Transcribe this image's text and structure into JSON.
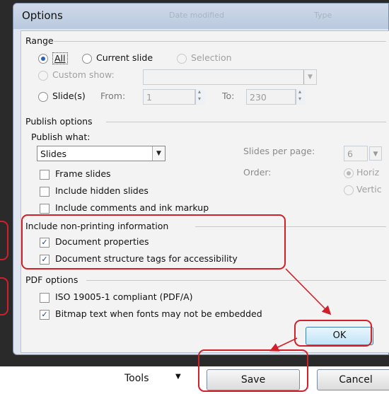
{
  "dialog": {
    "title": "Options",
    "ghost_header_left": "Date modified",
    "ghost_header_right": "Type"
  },
  "range": {
    "title": "Range",
    "all_label": "All",
    "current_slide_label": "Current slide",
    "selection_label": "Selection",
    "custom_show_label": "Custom show:",
    "slides_label": "Slide(s)",
    "from_label": "From:",
    "from_value": "1",
    "to_label": "To:",
    "to_value": "230"
  },
  "publish": {
    "title": "Publish options",
    "publish_what_label": "Publish what:",
    "publish_what_value": "Slides",
    "slides_per_page_label": "Slides per page:",
    "slides_per_page_value": "6",
    "order_label": "Order:",
    "order_horizontal": "Horiz",
    "order_vertical": "Vertic",
    "frame_slides": "Frame slides",
    "include_hidden": "Include hidden slides",
    "include_comments": "Include comments and ink markup"
  },
  "nonprinting": {
    "title": "Include non-printing information",
    "doc_properties": "Document properties",
    "doc_structure": "Document structure tags for accessibility"
  },
  "pdf": {
    "title": "PDF options",
    "iso": "ISO 19005-1 compliant (PDF/A)",
    "bitmap": "Bitmap text when fonts may not be embedded"
  },
  "buttons": {
    "ok": "OK",
    "tools": "Tools",
    "save": "Save",
    "cancel": "Cancel"
  },
  "checks": {
    "frame_slides": false,
    "include_hidden": false,
    "include_comments": false,
    "doc_properties": true,
    "doc_structure": true,
    "iso": false,
    "bitmap": true
  },
  "colors": {
    "annotation": "#d1202a",
    "accent": "#2a62b8"
  }
}
